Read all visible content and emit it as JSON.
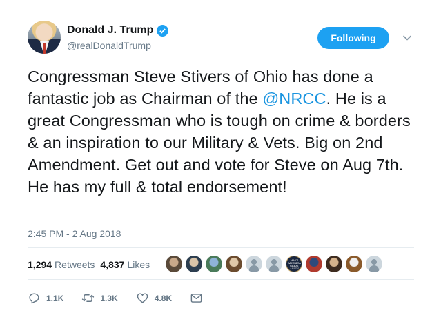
{
  "author": {
    "display_name": "Donald J. Trump",
    "handle": "@realDonaldTrump",
    "verified": true
  },
  "follow_button": {
    "label": "Following"
  },
  "tweet": {
    "text_before_mention": "Congressman Steve Stivers of Ohio has done a fantastic job as Chairman of the ",
    "mention": "@NRCC",
    "text_after_mention": ". He is a great Congressman who is tough on crime & borders & an inspiration to our Military & Vets. Big on 2nd Amendment. Get out and vote for Steve on Aug 7th. He has my full & total endorsement!",
    "timestamp": "2:45 PM - 2 Aug 2018"
  },
  "stats": {
    "retweets_count": "1,294",
    "retweets_label": "Retweets",
    "likes_count": "4,837",
    "likes_label": "Likes"
  },
  "likers": [
    {
      "type": "photo",
      "colors": [
        "#5a4a3a",
        "#c9a98a"
      ]
    },
    {
      "type": "photo",
      "colors": [
        "#2c3e50",
        "#d9c4a9"
      ]
    },
    {
      "type": "photo",
      "colors": [
        "#4a7b5a",
        "#8fb3d9"
      ]
    },
    {
      "type": "photo",
      "colors": [
        "#6b4b2e",
        "#e0c8a8"
      ]
    },
    {
      "type": "default"
    },
    {
      "type": "default"
    },
    {
      "type": "text-logo",
      "colors": [
        "#1a2740",
        "#ffffff"
      ],
      "text": "MAKE AMERICA GREAT AGAIN"
    },
    {
      "type": "photo",
      "colors": [
        "#b03a2e",
        "#2e4a7b"
      ]
    },
    {
      "type": "photo",
      "colors": [
        "#3d2b1f",
        "#d6b38c"
      ]
    },
    {
      "type": "photo",
      "colors": [
        "#8a5a2b",
        "#f0f0f0"
      ]
    },
    {
      "type": "default"
    }
  ],
  "actions": {
    "reply_count": "1.1K",
    "retweet_count": "1.3K",
    "like_count": "4.8K"
  },
  "colors": {
    "accent": "#1da1f2",
    "mention": "#1b95e0",
    "secondary_text": "#657786"
  }
}
